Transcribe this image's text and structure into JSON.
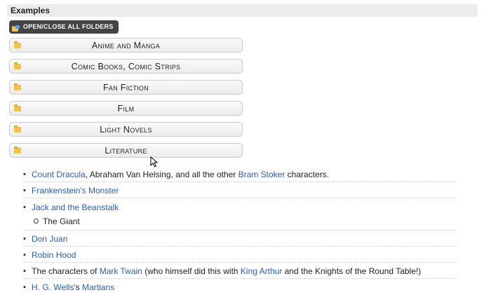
{
  "section": {
    "title": "Examples"
  },
  "toggle": {
    "label": "OPEN/CLOSE ALL FOLDERS"
  },
  "folders": [
    {
      "label": "Anime and Manga"
    },
    {
      "label": "Comic Books, Comic Strips"
    },
    {
      "label": "Fan Fiction"
    },
    {
      "label": "Film"
    },
    {
      "label": "Light Novels"
    },
    {
      "label": "Literature"
    }
  ],
  "items": [
    {
      "parts": [
        {
          "t": "Count Dracula",
          "link": true
        },
        {
          "t": ", Abraham Van Helsing, and all the other ",
          "link": false
        },
        {
          "t": "Bram Stoker",
          "link": true
        },
        {
          "t": " characters.",
          "link": false
        }
      ]
    },
    {
      "parts": [
        {
          "t": "Frankenstein's Monster",
          "link": true
        }
      ]
    },
    {
      "parts": [
        {
          "t": "Jack and the Beanstalk",
          "link": true
        }
      ],
      "sub": "The Giant"
    },
    {
      "parts": [
        {
          "t": "Don Juan",
          "link": true
        }
      ]
    },
    {
      "parts": [
        {
          "t": "Robin Hood",
          "link": true
        }
      ]
    },
    {
      "parts": [
        {
          "t": "The characters of ",
          "link": false
        },
        {
          "t": "Mark Twain",
          "link": true
        },
        {
          "t": " (who himself did this with ",
          "link": false
        },
        {
          "t": "King Arthur",
          "link": true
        },
        {
          "t": " and the Knights of the Round Table!)",
          "link": false
        }
      ]
    },
    {
      "parts": [
        {
          "t": "H. G. Wells",
          "link": true
        },
        {
          "t": "'s ",
          "link": false
        },
        {
          "t": "Martians",
          "link": true
        }
      ]
    }
  ],
  "colors": {
    "link": "#2a5db0",
    "folder_icon": "#f0c34a",
    "toggle_bg": "#444444"
  }
}
